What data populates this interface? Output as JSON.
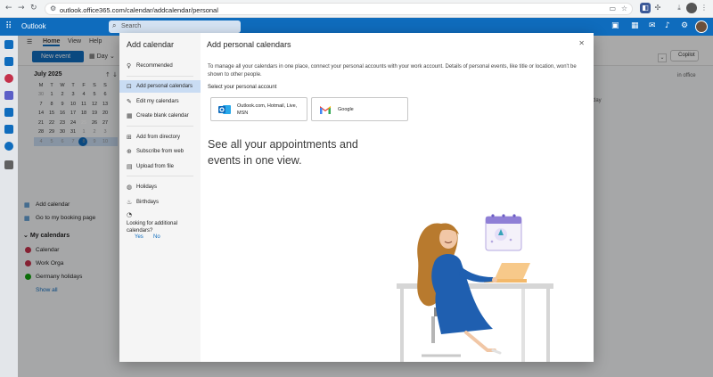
{
  "browser": {
    "url": "outlook.office365.com/calendar/addcalendar/personal"
  },
  "outlook": {
    "brand": "Outlook",
    "search_placeholder": "Search"
  },
  "ribbon": {
    "tabs": [
      "Home",
      "View",
      "Help"
    ],
    "new_event": "New event",
    "view_select": "Day",
    "copilot": "Copilot"
  },
  "mini_calendar": {
    "month": "July 2025",
    "weekdays": [
      "M",
      "T",
      "W",
      "T",
      "F",
      "S",
      "S"
    ],
    "weeks": [
      [
        "30",
        "1",
        "2",
        "3",
        "4",
        "5",
        "6"
      ],
      [
        "7",
        "8",
        "9",
        "10",
        "11",
        "12",
        "13"
      ],
      [
        "14",
        "15",
        "16",
        "17",
        "18",
        "19",
        "20"
      ],
      [
        "21",
        "22",
        "23",
        "24",
        "25",
        "26",
        "27"
      ],
      [
        "28",
        "29",
        "30",
        "31",
        "1",
        "2",
        "3"
      ],
      [
        "4",
        "5",
        "6",
        "7",
        "8",
        "9",
        "10"
      ]
    ]
  },
  "left_pane": {
    "add_calendar": "Add calendar",
    "booking_page": "Go to my booking page",
    "my_calendars_header": "My calendars",
    "calendars": [
      {
        "name": "Calendar",
        "color": "#c4314b"
      },
      {
        "name": "Work Orga",
        "color": "#c4314b"
      },
      {
        "name": "Germany holidays",
        "color": "#13a10e"
      }
    ],
    "show_all": "Show all"
  },
  "background_labels": {
    "in_office": "in office",
    "day": "day"
  },
  "dialog": {
    "sidebar_title": "Add calendar",
    "nav": [
      {
        "label": "Recommended",
        "icon": "lightbulb-icon"
      },
      {
        "label": "Add personal calendars",
        "icon": "person-calendar-icon"
      },
      {
        "label": "Edit my calendars",
        "icon": "edit-icon"
      },
      {
        "label": "Create blank calendar",
        "icon": "calendar-add-icon"
      },
      {
        "label": "Add from directory",
        "icon": "directory-icon"
      },
      {
        "label": "Subscribe from web",
        "icon": "globe-link-icon"
      },
      {
        "label": "Upload from file",
        "icon": "upload-icon"
      },
      {
        "label": "Holidays",
        "icon": "globe-icon"
      },
      {
        "label": "Birthdays",
        "icon": "cake-icon"
      }
    ],
    "feedback_question": "Looking for additional calendars?",
    "feedback_yes": "Yes",
    "feedback_no": "No",
    "main_title": "Add personal calendars",
    "description": "To manage all your calendars in one place, connect your personal accounts with your work account. Details of personal events, like title or location, won't be shown to other people.",
    "select_label": "Select your personal account",
    "accounts": [
      {
        "label": "Outlook.com, Hotmail, Live, MSN",
        "icon": "outlook-icon"
      },
      {
        "label": "Google",
        "icon": "gmail-icon"
      }
    ],
    "headline": "See all your appointments and events in one view."
  }
}
